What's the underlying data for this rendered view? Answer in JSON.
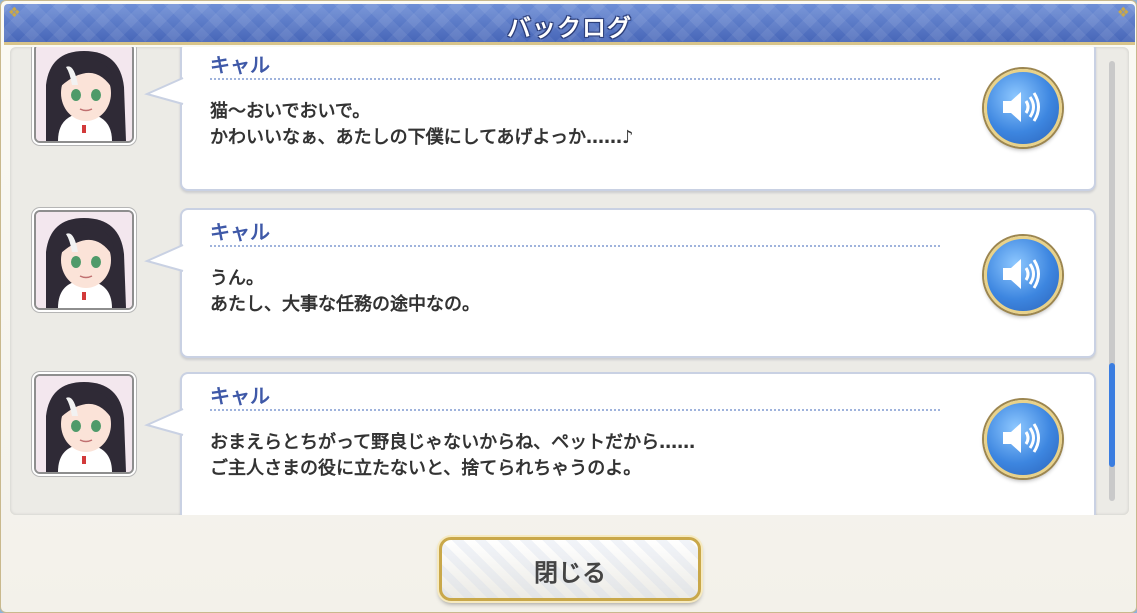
{
  "header": {
    "title": "バックログ"
  },
  "entries": [
    {
      "speaker": "キャル",
      "lines": [
        "猫〜おいでおいで。",
        "かわいいなぁ、あたしの下僕にしてあげよっか……♪"
      ]
    },
    {
      "speaker": "キャル",
      "lines": [
        "うん。",
        "あたし、大事な任務の途中なの。"
      ]
    },
    {
      "speaker": "キャル",
      "lines": [
        "おまえらとちがって野良じゃないからね、ペットだから……",
        "ご主人さまの役に立たないと、捨てられちゃうのよ。"
      ]
    }
  ],
  "footer": {
    "close_label": "閉じる"
  },
  "colors": {
    "accent": "#3f59a8",
    "title_bar": "#5574c4",
    "scroll_thumb": "#3a7de0",
    "gold_trim": "#c9a84a"
  },
  "icons": {
    "voice": "speaker-icon",
    "avatar": "character-portrait"
  }
}
